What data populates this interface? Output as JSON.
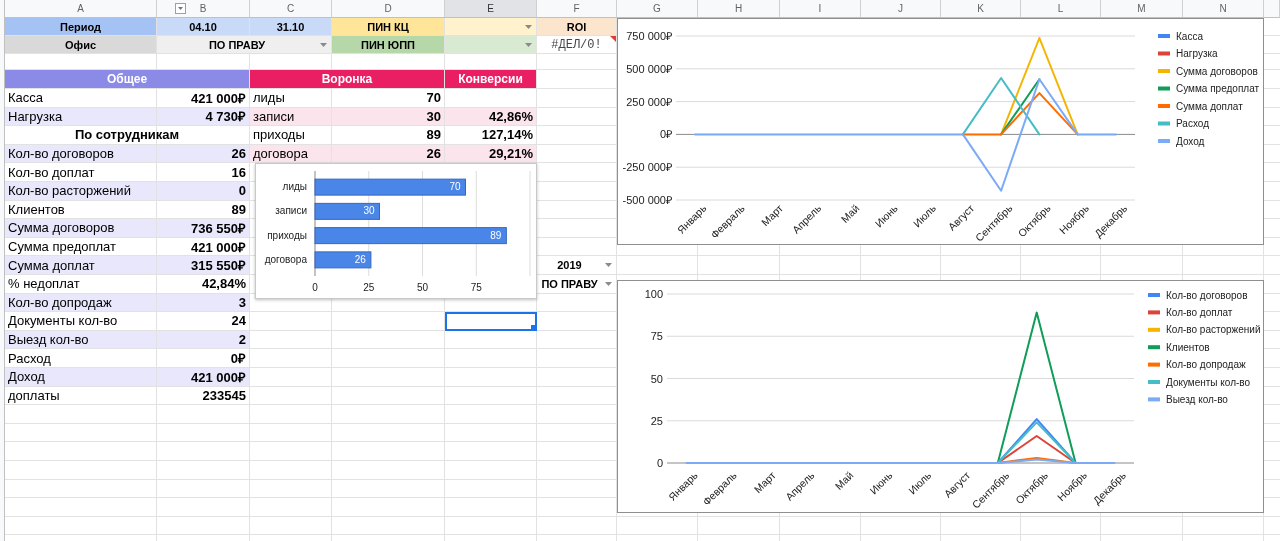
{
  "columns": [
    {
      "label": "A",
      "selected": false
    },
    {
      "label": "B",
      "selected": false,
      "filter": true
    },
    {
      "label": "C",
      "selected": false
    },
    {
      "label": "D",
      "selected": false
    },
    {
      "label": "E",
      "selected": true
    },
    {
      "label": "F",
      "selected": false
    },
    {
      "label": "G",
      "selected": false
    },
    {
      "label": "H",
      "selected": false
    },
    {
      "label": "I",
      "selected": false
    },
    {
      "label": "J",
      "selected": false
    },
    {
      "label": "K",
      "selected": false
    },
    {
      "label": "L",
      "selected": false
    },
    {
      "label": "M",
      "selected": false
    },
    {
      "label": "N",
      "selected": false
    }
  ],
  "rows": [
    {
      "A": {
        "text": "Период",
        "kind": "heading",
        "color": "#a4c2f4",
        "selected": false
      },
      "B": {
        "text": "04.10",
        "kind": "heading",
        "color": "#c9daf8",
        "selected": false
      },
      "C": {
        "text": "31.10",
        "kind": "heading",
        "color": "#c9daf8",
        "selected": false
      },
      "D": {
        "text": "ПИН КЦ",
        "kind": "heading",
        "color": "#ffe599",
        "selected": false
      },
      "E": {
        "kind": "dropdown",
        "color": "#fff2cc",
        "selected": false
      },
      "F": {
        "text": "ROI",
        "kind": "heading",
        "color": "#fce5cd",
        "selected": false
      }
    },
    {
      "A": {
        "text": "Офис",
        "kind": "heading",
        "color": "#d9d9d9",
        "selected": false
      },
      "B:C": {
        "text": "ПО ПРАВУ",
        "kind": "dropdown",
        "color": "#efefef",
        "selected": false
      },
      "D": {
        "text": "ПИН ЮПП",
        "kind": "heading",
        "color": "#b6d7a8",
        "selected": false
      },
      "E": {
        "kind": "dropdown",
        "color": "#d9ead3",
        "selected": false
      },
      "F": {
        "text": "#ДЕЛ/0!",
        "kind": "error",
        "selected": false
      }
    },
    {},
    {
      "A:B": {
        "text": "Общее",
        "kind": "banner",
        "color": "#8b8ae6",
        "selected": false
      },
      "C:D": {
        "text": "Воронка",
        "kind": "banner",
        "color": "#e91e63",
        "selected": false
      },
      "E": {
        "text": "Конверсии",
        "kind": "banner",
        "color": "#e91e63",
        "selected": false
      }
    },
    {
      "A": {
        "text": "Касса",
        "kind": "label",
        "selected": false
      },
      "B": {
        "text": "421 000₽",
        "kind": "number",
        "selected": false
      },
      "C": {
        "text": "лиды",
        "kind": "label",
        "selected": false
      },
      "D": {
        "text": "70",
        "kind": "number",
        "selected": false
      }
    },
    {
      "A": {
        "text": "Нагрузка",
        "kind": "label",
        "color": "#e8e7fc",
        "selected": false
      },
      "B": {
        "text": "4 730₽",
        "kind": "number",
        "color": "#e8e7fc",
        "selected": false
      },
      "C": {
        "text": "записи",
        "kind": "label",
        "color": "#fce4ec",
        "selected": false
      },
      "D": {
        "text": "30",
        "kind": "number",
        "color": "#fce4ec",
        "selected": false
      },
      "E": {
        "text": "42,86%",
        "kind": "number",
        "color": "#fce4ec",
        "selected": false
      }
    },
    {
      "A:B": {
        "text": "По сотрудникам",
        "kind": "title",
        "selected": false
      },
      "C": {
        "text": "приходы",
        "kind": "label",
        "selected": false
      },
      "D": {
        "text": "89",
        "kind": "number",
        "selected": false
      },
      "E": {
        "text": "127,14%",
        "kind": "number",
        "selected": false
      }
    },
    {
      "A": {
        "text": "Кол-во договоров",
        "kind": "label",
        "color": "#e8e7fc",
        "selected": false
      },
      "B": {
        "text": "26",
        "kind": "number",
        "color": "#e8e7fc",
        "selected": false
      },
      "C": {
        "text": "договора",
        "kind": "label",
        "color": "#fce4ec",
        "selected": false
      },
      "D": {
        "text": "26",
        "kind": "number",
        "color": "#fce4ec",
        "selected": false
      },
      "E": {
        "text": "29,21%",
        "kind": "number",
        "color": "#fce4ec",
        "selected": false
      }
    },
    {
      "A": {
        "text": "Кол-во доплат",
        "kind": "label",
        "selected": false
      },
      "B": {
        "text": "16",
        "kind": "number",
        "selected": false
      }
    },
    {
      "A": {
        "text": "Кол-во расторжений",
        "kind": "label",
        "color": "#e8e7fc",
        "selected": false
      },
      "B": {
        "text": "0",
        "kind": "number",
        "color": "#e8e7fc",
        "selected": false
      }
    },
    {
      "A": {
        "text": "Клиентов",
        "kind": "label",
        "selected": false
      },
      "B": {
        "text": "89",
        "kind": "number",
        "selected": false
      }
    },
    {
      "A": {
        "text": "Сумма договоров",
        "kind": "label",
        "color": "#e8e7fc",
        "selected": false
      },
      "B": {
        "text": "736 550₽",
        "kind": "number",
        "color": "#e8e7fc",
        "selected": false
      }
    },
    {
      "A": {
        "text": "Сумма предоплат",
        "kind": "label",
        "selected": false
      },
      "B": {
        "text": "421 000₽",
        "kind": "number",
        "selected": false
      }
    },
    {
      "A": {
        "text": "Сумма доплат",
        "kind": "label",
        "color": "#e8e7fc",
        "selected": false
      },
      "B": {
        "text": "315 550₽",
        "kind": "number",
        "color": "#e8e7fc",
        "selected": false
      },
      "F": {
        "text": "2019",
        "kind": "dropdown",
        "selected": false
      }
    },
    {
      "A": {
        "text": "% недоплат",
        "kind": "label",
        "selected": false
      },
      "B": {
        "text": "42,84%",
        "kind": "number",
        "selected": false
      },
      "F": {
        "text": "ПО ПРАВУ",
        "kind": "dropdown",
        "selected": false
      }
    },
    {
      "A": {
        "text": "Кол-во допродаж",
        "kind": "label",
        "color": "#e8e7fc",
        "selected": false
      },
      "B": {
        "text": "3",
        "kind": "number",
        "color": "#e8e7fc",
        "selected": false
      }
    },
    {
      "A": {
        "text": "Документы кол-во",
        "kind": "label",
        "selected": false
      },
      "B": {
        "text": "24",
        "kind": "number",
        "selected": false
      },
      "E": {
        "selected": true
      }
    },
    {
      "A": {
        "text": "Выезд кол-во",
        "kind": "label",
        "color": "#e8e7fc",
        "selected": false
      },
      "B": {
        "text": "2",
        "kind": "number",
        "color": "#e8e7fc",
        "selected": false
      }
    },
    {
      "A": {
        "text": "Расход",
        "kind": "label",
        "selected": false
      },
      "B": {
        "text": "0₽",
        "kind": "number",
        "selected": false
      }
    },
    {
      "A": {
        "text": "Доход",
        "kind": "label",
        "color": "#e8e7fc",
        "selected": false
      },
      "B": {
        "text": "421 000₽",
        "kind": "number",
        "color": "#e8e7fc",
        "selected": false
      }
    },
    {
      "A": {
        "text": "доплаты",
        "kind": "label",
        "selected": false
      },
      "B": {
        "text": "233545",
        "kind": "number",
        "selected": false
      }
    }
  ],
  "charts": [
    {
      "chart_data": {
        "type": "line",
        "grid": true,
        "legend": "right",
        "categories": [
          "Январь",
          "Февраль",
          "Март",
          "Апрель",
          "Май",
          "Июнь",
          "Июль",
          "Август",
          "Сентябрь",
          "Октябрь",
          "Ноябрь",
          "Декабрь"
        ],
        "ylim": [
          -500000,
          750000
        ],
        "yticks": [
          {
            "value": -500000,
            "label": "-500 000₽"
          },
          {
            "value": -250000,
            "label": "-250 000₽"
          },
          {
            "value": 0,
            "label": "0₽"
          },
          {
            "value": 250000,
            "label": "250 000₽"
          },
          {
            "value": 500000,
            "label": "500 000₽"
          },
          {
            "value": 750000,
            "label": "750 000₽"
          }
        ],
        "series": [
          {
            "name": "Касса",
            "color": "#4285f4",
            "values": [
              null,
              null,
              null,
              null,
              null,
              null,
              null,
              null,
              null,
              null,
              null,
              null
            ]
          },
          {
            "name": "Нагрузка",
            "color": "#db4437",
            "values": [
              null,
              null,
              null,
              null,
              null,
              null,
              null,
              null,
              null,
              null,
              null,
              null
            ]
          },
          {
            "name": "Сумма договоров",
            "color": "#f4b400",
            "values": [
              null,
              null,
              null,
              null,
              null,
              null,
              null,
              null,
              0,
              735000,
              0,
              null
            ]
          },
          {
            "name": "Сумма предоплат",
            "color": "#0f9d58",
            "values": [
              null,
              null,
              null,
              null,
              null,
              null,
              null,
              null,
              0,
              420000,
              null,
              null
            ]
          },
          {
            "name": "Сумма доплат",
            "color": "#ff6d01",
            "values": [
              null,
              null,
              null,
              null,
              null,
              null,
              null,
              0,
              0,
              315000,
              0,
              null
            ]
          },
          {
            "name": "Расход",
            "color": "#46bdc6",
            "values": [
              null,
              null,
              null,
              null,
              null,
              null,
              null,
              0,
              430000,
              0,
              null,
              null
            ]
          },
          {
            "name": "Доход",
            "color": "#7baaf7",
            "values": [
              0,
              0,
              0,
              0,
              0,
              0,
              0,
              0,
              -430000,
              420000,
              0,
              0
            ]
          }
        ]
      }
    },
    {
      "chart_data": {
        "type": "bar",
        "grid": true,
        "orientation": "horizontal",
        "categories": [
          "лиды",
          "записи",
          "приходы",
          "договора"
        ],
        "values": [
          70,
          30,
          89,
          26
        ],
        "xlim": [
          0,
          100
        ],
        "xticks": [
          0,
          25,
          50,
          75
        ],
        "data_labels": true
      }
    },
    {
      "chart_data": {
        "type": "line",
        "grid": true,
        "legend": "right",
        "categories": [
          "Январь",
          "Февраль",
          "Март",
          "Апрель",
          "Май",
          "Июнь",
          "Июль",
          "Август",
          "Сентябрь",
          "Октябрь",
          "Ноябрь",
          "Декабрь"
        ],
        "ylim": [
          0,
          100
        ],
        "yticks": [
          0,
          25,
          50,
          75,
          100
        ],
        "series": [
          {
            "name": "Кол-во договоров",
            "color": "#4285f4",
            "values": [
              null,
              null,
              null,
              null,
              null,
              null,
              null,
              null,
              0,
              26,
              0,
              null
            ]
          },
          {
            "name": "Кол-во доплат",
            "color": "#db4437",
            "values": [
              null,
              null,
              null,
              null,
              null,
              null,
              null,
              null,
              0,
              16,
              0,
              null
            ]
          },
          {
            "name": "Кол-во расторжений",
            "color": "#f4b400",
            "values": [
              null,
              null,
              null,
              null,
              null,
              null,
              null,
              null,
              null,
              null,
              null,
              null
            ]
          },
          {
            "name": "Клиентов",
            "color": "#0f9d58",
            "values": [
              null,
              null,
              null,
              null,
              null,
              null,
              null,
              null,
              0,
              89,
              0,
              null
            ]
          },
          {
            "name": "Кол-во допродаж",
            "color": "#ff6d01",
            "values": [
              null,
              null,
              null,
              null,
              null,
              null,
              null,
              null,
              0,
              3,
              0,
              null
            ]
          },
          {
            "name": "Документы кол-во",
            "color": "#46bdc6",
            "values": [
              null,
              null,
              null,
              null,
              null,
              null,
              null,
              null,
              0,
              24,
              0,
              null
            ]
          },
          {
            "name": "Выезд кол-во",
            "color": "#7baaf7",
            "values": [
              0,
              0,
              0,
              0,
              0,
              0,
              0,
              0,
              0,
              2,
              0,
              0
            ]
          }
        ]
      }
    }
  ]
}
